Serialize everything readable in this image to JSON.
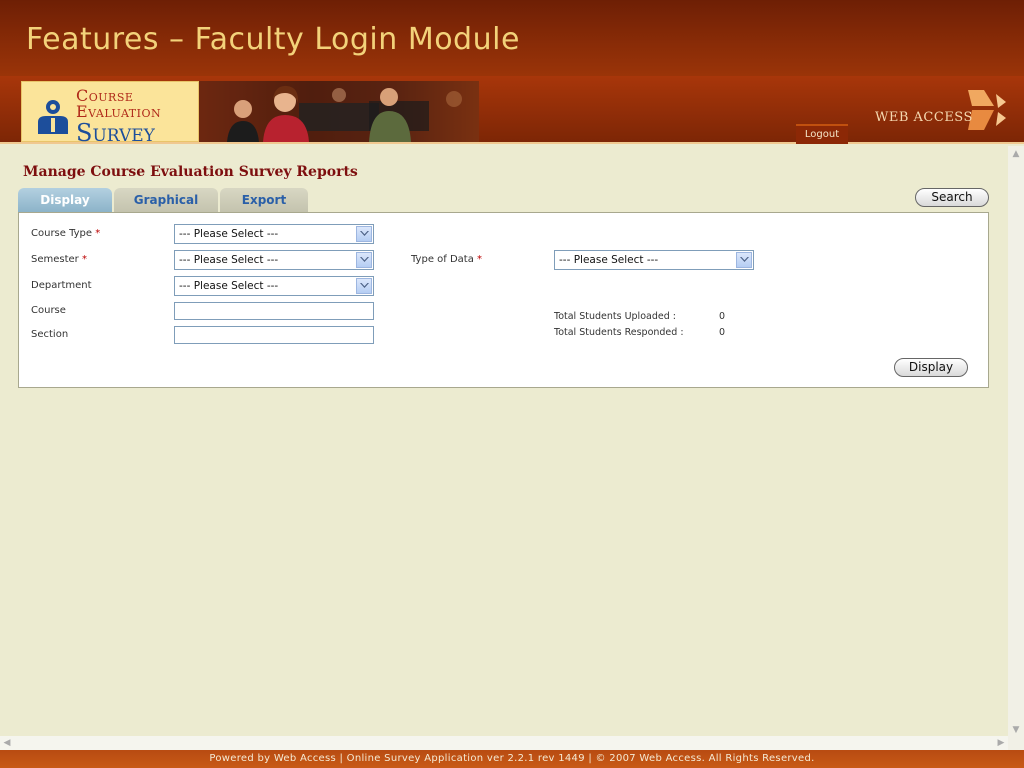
{
  "header": {
    "title": "Features – Faculty Login Module"
  },
  "banner": {
    "logo_line1": "Course",
    "logo_line2": "Evaluation",
    "logo_line3": "Survey",
    "logout_label": "Logout",
    "brand_text": "WEB ACCESS"
  },
  "page": {
    "heading": "Manage Course Evaluation Survey Reports"
  },
  "tabs": [
    {
      "label": "Display",
      "active": true
    },
    {
      "label": "Graphical",
      "active": false
    },
    {
      "label": "Export",
      "active": false
    }
  ],
  "search_button": "Search",
  "form": {
    "course_type_label": "Course Type",
    "semester_label": "Semester",
    "department_label": "Department",
    "course_label": "Course",
    "section_label": "Section",
    "type_of_data_label": "Type of Data",
    "required_mark": "*",
    "course_type_value": "--- Please Select ---",
    "semester_value": "--- Please Select ---",
    "department_value": "--- Please Select ---",
    "type_of_data_value": "--- Please Select ---",
    "course_value": "",
    "section_value": ""
  },
  "stats": {
    "uploaded_label": "Total Students Uploaded :",
    "uploaded_value": "0",
    "responded_label": "Total Students Responded :",
    "responded_value": "0"
  },
  "display_button": "Display",
  "footer": {
    "text": "Powered by Web Access | Online Survey Application ver 2.2.1 rev 1449 | © 2007 Web Access. All Rights Reserved."
  },
  "colors": {
    "accent": "#8a2c07",
    "title_text": "#f3d27a",
    "heading": "#7d0e0e",
    "background": "#ecebd0"
  },
  "icons": [
    "person-logo-icon",
    "dropdown-arrow-icon",
    "scroll-up-icon",
    "scroll-down-icon",
    "scroll-left-icon",
    "scroll-right-icon",
    "web-access-logo-icon"
  ]
}
